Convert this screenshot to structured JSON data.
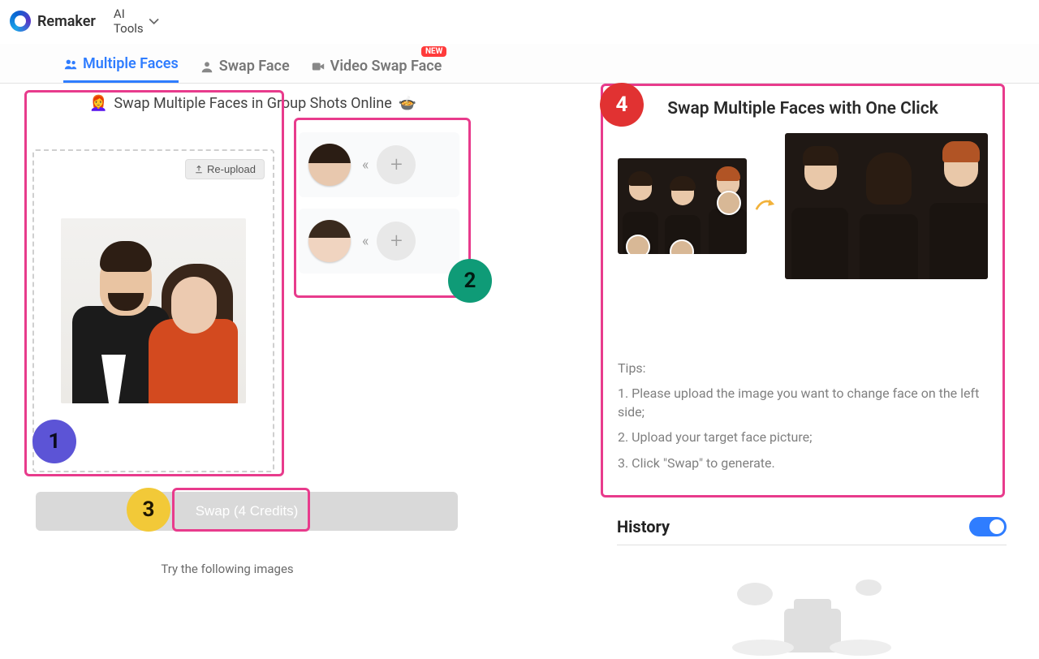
{
  "header": {
    "brand": "Remaker",
    "ai_tools": "AI Tools"
  },
  "tabs": {
    "multiple": "Multiple Faces",
    "swap": "Swap Face",
    "video": "Video Swap Face",
    "new_badge": "NEW"
  },
  "subtitle": "Swap Multiple Faces in Group Shots Online",
  "reupload": "Re-upload",
  "swap_button": "Swap (4 Credits)",
  "try_text": "Try the following images",
  "callouts": {
    "one": "1",
    "two": "2",
    "three": "3",
    "four": "4"
  },
  "info": {
    "title": "Swap Multiple Faces with One Click",
    "tips_label": "Tips:",
    "tip1": "1. Please upload the image you want to change face on the left side;",
    "tip2": "2. Upload your target face picture;",
    "tip3": "3. Click \"Swap\" to generate."
  },
  "history": {
    "label": "History",
    "enabled": true
  },
  "colors": {
    "highlight": "#e83b8c",
    "primary": "#2f7dff"
  }
}
